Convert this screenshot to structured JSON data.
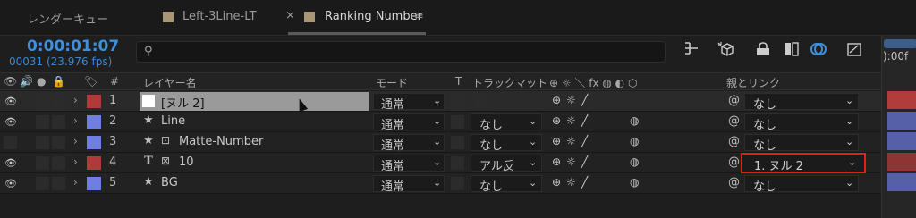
{
  "tabs": {
    "render_queue": "レンダーキュー",
    "comp1": "Left-3Line-LT",
    "comp2": "Ranking Number",
    "close_glyph": "×",
    "menu_glyph": "≡"
  },
  "time": {
    "timecode": "0:00:01:07",
    "frames": "00031 (23.976 fps)"
  },
  "search": {
    "icon": "⚲",
    "placeholder": ""
  },
  "headers": {
    "hash": "#",
    "layer_name": "レイヤー名",
    "mode": "モード",
    "t": "T",
    "track_matte": "トラックマット",
    "switches": "⊕ ☼ ＼ fx ◍ ◐ ⬡",
    "parent_link": "親とリンク"
  },
  "layers": [
    {
      "num": "1",
      "name": "[ヌル 2]",
      "mode": "通常",
      "matte": "",
      "parent": "なし",
      "color": "#b03a3a"
    },
    {
      "num": "2",
      "name": "Line",
      "mode": "通常",
      "matte": "なし",
      "parent": "なし",
      "color": "#6f7fe0"
    },
    {
      "num": "3",
      "name": "Matte-Number",
      "mode": "通常",
      "matte": "なし",
      "parent": "なし",
      "color": "#6f7fe0"
    },
    {
      "num": "4",
      "name": "10",
      "mode": "通常",
      "matte": "アル反",
      "parent": "1. ヌル 2",
      "color": "#b03a3a"
    },
    {
      "num": "5",
      "name": "BG",
      "mode": "通常",
      "matte": "なし",
      "parent": "なし",
      "color": "#6f7fe0"
    }
  ],
  "timeline": {
    "label": "):00f"
  },
  "colors": {
    "accent": "#3e8fdc",
    "highlight": "#e2230f"
  }
}
